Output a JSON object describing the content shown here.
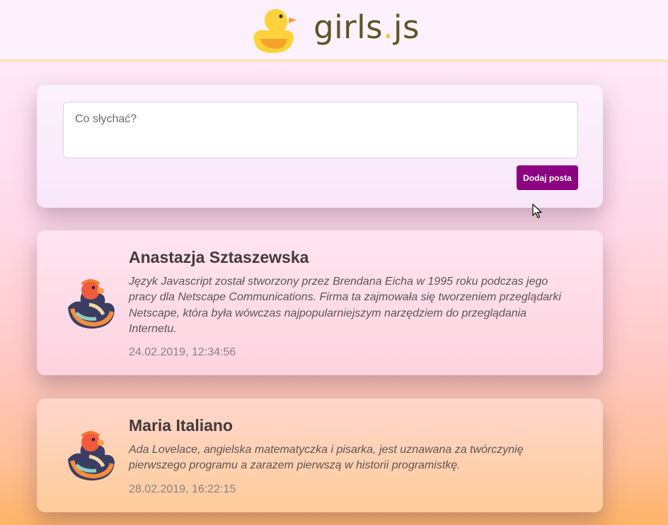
{
  "header": {
    "brand_main": "girls",
    "brand_dot": ".",
    "brand_ext": "js",
    "logo_icon": "rubber-duck-icon"
  },
  "composer": {
    "placeholder": "Co słychać?",
    "submit_label": "Dodaj posta"
  },
  "posts": [
    {
      "author": "Anastazja Sztaszewska",
      "content": "Język Javascript został stworzony przez Brendana Eicha w 1995 roku podczas jego pracy dla Netscape Communications. Firma ta zajmowała się tworzeniem przeglądarki Netscape, która była wówczas najpopularniejszym narzędziem do przeglądania Internetu.",
      "date": "24.02.2019, 12:34:56",
      "avatar_icon": "striped-duck-icon"
    },
    {
      "author": "Maria Italiano",
      "content": "Ada Lovelace, angielska matematyczka i pisarka, jest uznawana za twórczynię pierwszego programu a zarazem pierwszą w historii programistkę.",
      "date": "28.02.2019, 16:22:15",
      "avatar_icon": "striped-duck-icon"
    }
  ],
  "colors": {
    "accent_button": "#8b0080",
    "brand_text": "#5f5327",
    "brand_dot": "#f4c531"
  }
}
